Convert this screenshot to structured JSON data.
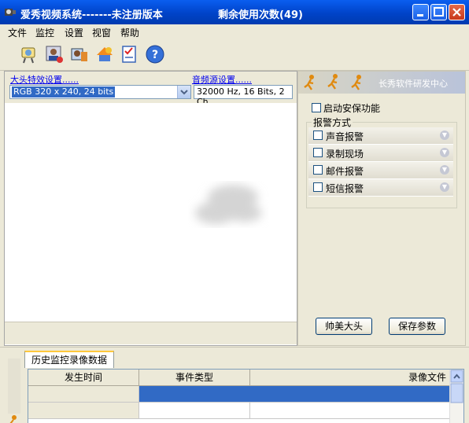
{
  "window": {
    "title": "爱秀视频系统-------未注册版本",
    "remaining_uses": "剩余使用次数(49)"
  },
  "menu": [
    "文件",
    "监控",
    "设置",
    "视窗",
    "帮助"
  ],
  "toolbar": {
    "icons": [
      "camera-icon",
      "user-icon",
      "record-icon",
      "export-icon",
      "checklist-icon",
      "help-icon"
    ]
  },
  "video_settings": {
    "head_effect_link": "大头特效设置......",
    "head_effect_value": "RGB 320 x 240, 24 bits",
    "audio_source_link": "音频源设置......",
    "audio_source_value": "32000 Hz, 16 Bits, 2 Ch"
  },
  "right_panel": {
    "banner_text": "长秀软件研发中心",
    "security_checkbox_label": "启动安保功能",
    "alarm_group_label": "报警方式",
    "alarms": [
      "声音报警",
      "录制现场",
      "邮件报警",
      "短信报警"
    ],
    "handsome_button": "帅美大头",
    "save_button": "保存参数"
  },
  "bottom": {
    "tab_label": "历史监控录像数据",
    "columns": [
      "发生时间",
      "事件类型",
      "录像文件"
    ]
  },
  "colors": {
    "titlebar": "#0054e3",
    "selection": "#316ac5"
  }
}
